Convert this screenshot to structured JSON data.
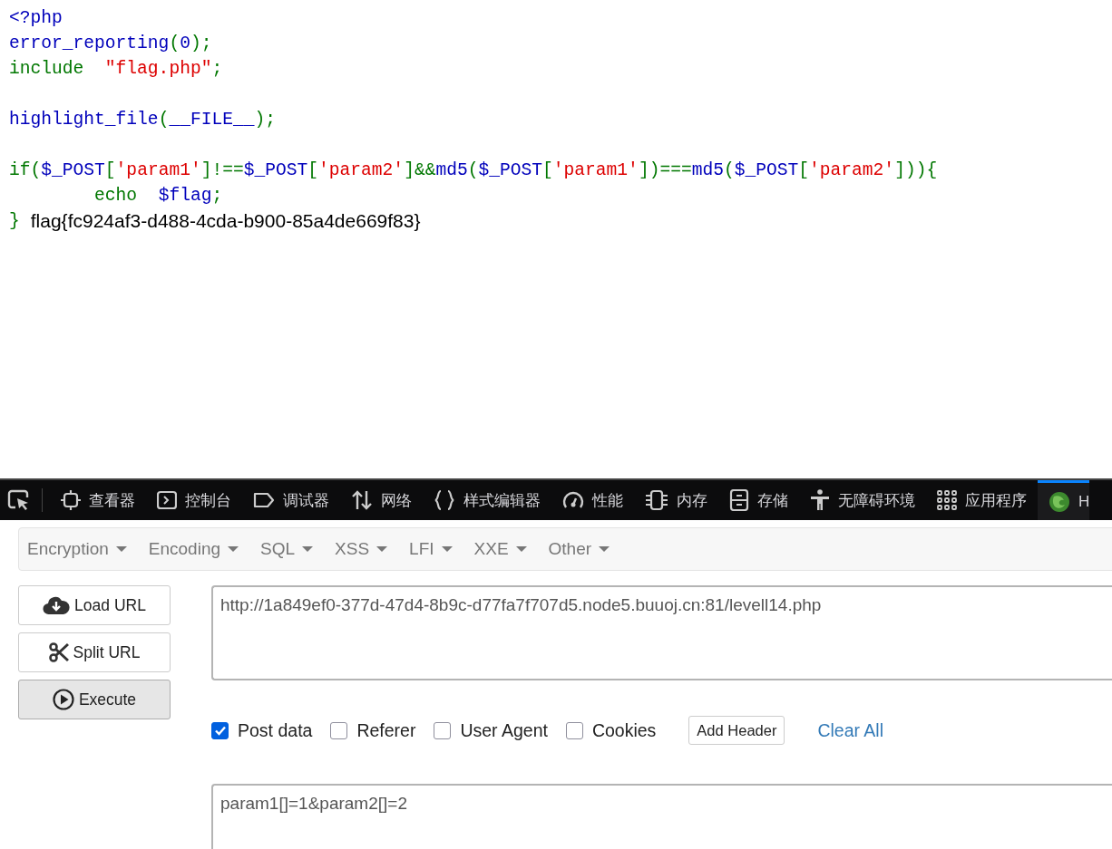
{
  "code_blocks": [
    {
      "lines": [
        {
          "tokens": [
            {
              "kind": "default",
              "text": "<?php"
            }
          ]
        },
        {
          "tokens": [
            {
              "kind": "default",
              "text": "error_reporting"
            },
            {
              "kind": "keyword",
              "text": "("
            },
            {
              "kind": "default",
              "text": "0"
            },
            {
              "kind": "keyword",
              "text": ");"
            }
          ]
        },
        {
          "tokens": [
            {
              "kind": "keyword",
              "text": "include  "
            },
            {
              "kind": "string",
              "text": "\"flag.php\""
            },
            {
              "kind": "keyword",
              "text": ";"
            }
          ]
        }
      ]
    },
    {
      "lines": [
        {
          "tokens": [
            {
              "kind": "default",
              "text": "highlight_file"
            },
            {
              "kind": "keyword",
              "text": "("
            },
            {
              "kind": "default",
              "text": "__FILE__"
            },
            {
              "kind": "keyword",
              "text": ");"
            }
          ]
        }
      ]
    },
    {
      "lines": [
        {
          "tokens": [
            {
              "kind": "keyword",
              "text": "if("
            },
            {
              "kind": "default",
              "text": "$_POST"
            },
            {
              "kind": "keyword",
              "text": "["
            },
            {
              "kind": "string",
              "text": "'param1'"
            },
            {
              "kind": "keyword",
              "text": "]!=="
            },
            {
              "kind": "default",
              "text": "$_POST"
            },
            {
              "kind": "keyword",
              "text": "["
            },
            {
              "kind": "string",
              "text": "'param2'"
            },
            {
              "kind": "keyword",
              "text": "]&&"
            },
            {
              "kind": "default",
              "text": "md5"
            },
            {
              "kind": "keyword",
              "text": "("
            },
            {
              "kind": "default",
              "text": "$_POST"
            },
            {
              "kind": "keyword",
              "text": "["
            },
            {
              "kind": "string",
              "text": "'param1'"
            },
            {
              "kind": "keyword",
              "text": "])==="
            },
            {
              "kind": "default",
              "text": "md5"
            },
            {
              "kind": "keyword",
              "text": "("
            },
            {
              "kind": "default",
              "text": "$_POST"
            },
            {
              "kind": "keyword",
              "text": "["
            },
            {
              "kind": "string",
              "text": "'param2'"
            },
            {
              "kind": "keyword",
              "text": "])){"
            }
          ]
        },
        {
          "tokens": [
            {
              "kind": "keyword",
              "text": "        echo  "
            },
            {
              "kind": "default",
              "text": "$flag"
            },
            {
              "kind": "keyword",
              "text": ";"
            }
          ]
        },
        {
          "tokens": [
            {
              "kind": "keyword",
              "text": "}"
            }
          ],
          "output": "flag{fc924af3-d488-4cda-b900-85a4de669f83}"
        }
      ]
    }
  ],
  "devtools": {
    "tabs": [
      {
        "label": "查看器",
        "selected": false
      },
      {
        "label": "控制台",
        "selected": false
      },
      {
        "label": "调试器",
        "selected": false
      },
      {
        "label": "网络",
        "selected": false
      },
      {
        "label": "样式编辑器",
        "selected": false
      },
      {
        "label": "性能",
        "selected": false
      },
      {
        "label": "内存",
        "selected": false
      },
      {
        "label": "存储",
        "selected": false
      },
      {
        "label": "无障碍环境",
        "selected": false
      },
      {
        "label": "应用程序",
        "selected": false
      },
      {
        "label": "H",
        "selected": true
      }
    ]
  },
  "hackbar": {
    "menus": [
      "Encryption",
      "Encoding",
      "SQL",
      "XSS",
      "LFI",
      "XXE",
      "Other"
    ],
    "buttons": [
      {
        "label": "Load URL",
        "kind": "load",
        "pressed": false
      },
      {
        "label": "Split URL",
        "kind": "split",
        "pressed": false
      },
      {
        "label": "Execute",
        "kind": "execute",
        "pressed": true
      }
    ],
    "url": "http://1a849ef0-377d-47d4-8b9c-d77fa7f707d5.node5.buuoj.cn:81/levell14.php",
    "options": [
      {
        "label": "Post data",
        "checked": true
      },
      {
        "label": "Referer",
        "checked": false
      },
      {
        "label": "User Agent",
        "checked": false
      },
      {
        "label": "Cookies",
        "checked": false
      }
    ],
    "add_header": "Add Header",
    "clear_all": "Clear All",
    "post_data": "param1[]=1&param2[]=2"
  }
}
